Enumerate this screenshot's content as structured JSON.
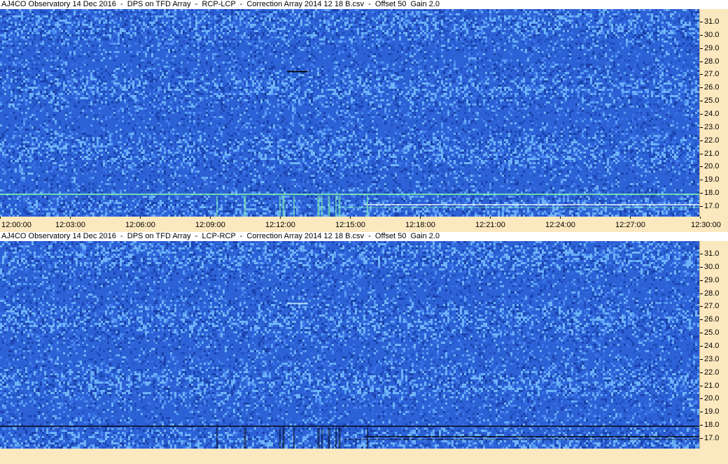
{
  "colors": {
    "axis_background": "#fce8bf",
    "spectrogram_base": "#2a5fd4",
    "emission_band": "#7ff0b0",
    "absorption_band": "#0a0f30"
  },
  "panels": [
    {
      "id": "top",
      "title": "AJ4CO Observatory 14 Dec 2016  -  DPS on TFD Array  -  RCP-LCP  -  Correction Array 2014 12 18 B.csv  -  Offset 50  Gain 2.0",
      "polarity": "emission",
      "time_labels": [
        "12:00:00",
        "12:03:00",
        "12:06:00",
        "12:09:00",
        "12:12:00",
        "12:15:00",
        "12:18:00",
        "12:21:00",
        "12:24:00",
        "12:27:00",
        "12:30:00"
      ]
    },
    {
      "id": "bottom",
      "title": "AJ4CO Observatory 14 Dec 2016  -  DPS on TFD Array  -  LCP-RCP  -  Correction Array 2014 12 18 B.csv  -  Offset 50  Gain 2.0",
      "polarity": "absorption",
      "time_labels": []
    }
  ],
  "freq_labels": [
    "31.0",
    "30.0",
    "29.0",
    "28.0",
    "27.0",
    "26.0",
    "25.0",
    "24.0",
    "23.0",
    "22.0",
    "21.0",
    "20.0",
    "19.0",
    "18.0",
    "17.0"
  ]
}
